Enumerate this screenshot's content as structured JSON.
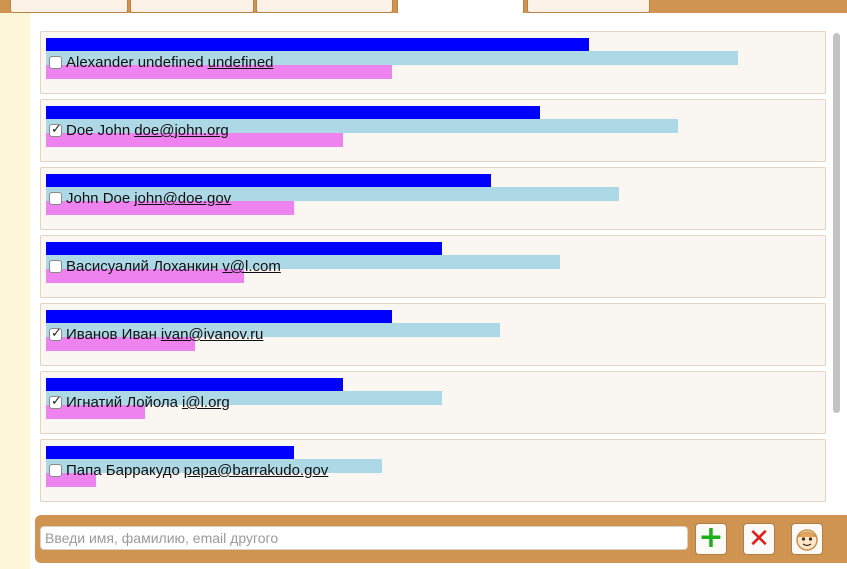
{
  "contacts": [
    {
      "name": "Alexander undefined",
      "email": "undefined",
      "checked": false
    },
    {
      "name": "Doe John",
      "email": "doe@john.org",
      "checked": true
    },
    {
      "name": "John Doe",
      "email": "john@doe.gov",
      "checked": false
    },
    {
      "name": "Васисуалий Лоханкин",
      "email": "v@l.com",
      "checked": false
    },
    {
      "name": "Иванов Иван",
      "email": "ivan@ivanov.ru",
      "checked": true
    },
    {
      "name": "Игнатий Лойола",
      "email": "i@l.org",
      "checked": true
    },
    {
      "name": "Папа Барракудо",
      "email": "papa@barrakudo.gov",
      "checked": false
    }
  ],
  "input": {
    "placeholder": "Введи имя, фамилию, email другого",
    "value": ""
  },
  "buttons": {
    "add_icon": "plus-icon",
    "delete_icon": "x-icon",
    "avatar_icon": "smiley-face-icon"
  },
  "colors": {
    "bar_blue": "#0000ff",
    "bar_light": "#add8e6",
    "bar_pink": "#ee82ee",
    "accent": "#cf944f",
    "add_green": "#19b019",
    "delete_red": "#e01c1c"
  }
}
